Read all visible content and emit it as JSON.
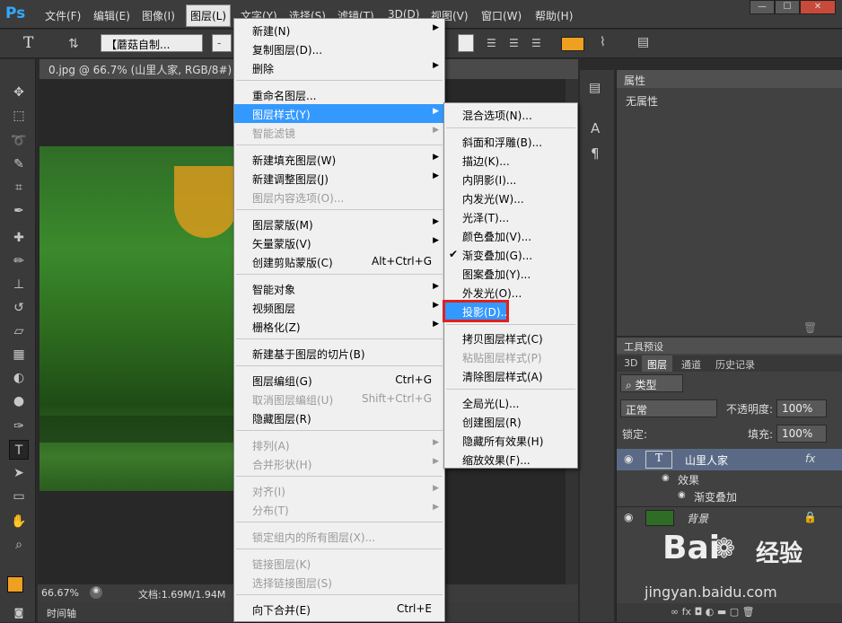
{
  "menubar": {
    "logo": "Ps",
    "items": [
      "文件(F)",
      "编辑(E)",
      "图像(I)",
      "图层(L)",
      "文字(Y)",
      "选择(S)",
      "滤镜(T)",
      "3D(D)",
      "视图(V)",
      "窗口(W)",
      "帮助(H)"
    ],
    "window_buttons": [
      "—",
      "☐",
      "✕"
    ]
  },
  "optbar": {
    "tool_icon": "T",
    "font_name": "【蘑菇自制...",
    "size_placeholder": "-"
  },
  "document": {
    "tab_title": "0.jpg @ 66.7% (山里人家, RGB/8#) *",
    "zoom": "66.67%",
    "doc_size": "文档:1.69M/1.94M",
    "timeline_label": "时间轴"
  },
  "properties": {
    "tab": "属性",
    "content": "无属性"
  },
  "panels": {
    "tool_presets": "工具预设",
    "tabs": [
      "3D",
      "图层",
      "通道",
      "历史记录"
    ],
    "filter_kind": "类型",
    "blend_mode": "正常",
    "opacity_label": "不透明度:",
    "opacity_value": "100%",
    "lock_label": "锁定:",
    "fill_label": "填充:",
    "fill_value": "100%",
    "layers": [
      {
        "name": "山里人家",
        "badge": "fx"
      },
      {
        "name": "效果"
      },
      {
        "name": "渐变叠加"
      },
      {
        "name": "背景"
      }
    ]
  },
  "layer_menu": {
    "items": [
      {
        "label": "新建(N)",
        "shortcut": "",
        "arrow": "▶",
        "disabled": false
      },
      {
        "label": "复制图层(D)...",
        "shortcut": "",
        "arrow": "",
        "disabled": false
      },
      {
        "label": "删除",
        "shortcut": "",
        "arrow": "▶",
        "disabled": false
      },
      {
        "label": "重命名图层...",
        "shortcut": "",
        "arrow": "",
        "disabled": false
      },
      {
        "label": "图层样式(Y)",
        "shortcut": "",
        "arrow": "▶",
        "disabled": false
      },
      {
        "label": "智能滤镜",
        "shortcut": "",
        "arrow": "▶",
        "disabled": true
      },
      {
        "label": "新建填充图层(W)",
        "shortcut": "",
        "arrow": "▶",
        "disabled": false
      },
      {
        "label": "新建调整图层(J)",
        "shortcut": "",
        "arrow": "▶",
        "disabled": false
      },
      {
        "label": "图层内容选项(O)...",
        "shortcut": "",
        "arrow": "",
        "disabled": true
      },
      {
        "label": "图层蒙版(M)",
        "shortcut": "",
        "arrow": "▶",
        "disabled": false
      },
      {
        "label": "矢量蒙版(V)",
        "shortcut": "",
        "arrow": "▶",
        "disabled": false
      },
      {
        "label": "创建剪贴蒙版(C)",
        "shortcut": "Alt+Ctrl+G",
        "arrow": "",
        "disabled": false
      },
      {
        "label": "智能对象",
        "shortcut": "",
        "arrow": "▶",
        "disabled": false
      },
      {
        "label": "视频图层",
        "shortcut": "",
        "arrow": "▶",
        "disabled": false
      },
      {
        "label": "栅格化(Z)",
        "shortcut": "",
        "arrow": "▶",
        "disabled": false
      },
      {
        "label": "新建基于图层的切片(B)",
        "shortcut": "",
        "arrow": "",
        "disabled": false
      },
      {
        "label": "图层编组(G)",
        "shortcut": "Ctrl+G",
        "arrow": "",
        "disabled": false
      },
      {
        "label": "取消图层编组(U)",
        "shortcut": "Shift+Ctrl+G",
        "arrow": "",
        "disabled": true
      },
      {
        "label": "隐藏图层(R)",
        "shortcut": "",
        "arrow": "",
        "disabled": false
      },
      {
        "label": "排列(A)",
        "shortcut": "",
        "arrow": "▶",
        "disabled": true
      },
      {
        "label": "合并形状(H)",
        "shortcut": "",
        "arrow": "▶",
        "disabled": true
      },
      {
        "label": "对齐(I)",
        "shortcut": "",
        "arrow": "▶",
        "disabled": true
      },
      {
        "label": "分布(T)",
        "shortcut": "",
        "arrow": "▶",
        "disabled": true
      },
      {
        "label": "锁定组内的所有图层(X)...",
        "shortcut": "",
        "arrow": "",
        "disabled": true
      },
      {
        "label": "链接图层(K)",
        "shortcut": "",
        "arrow": "",
        "disabled": true
      },
      {
        "label": "选择链接图层(S)",
        "shortcut": "",
        "arrow": "",
        "disabled": true
      },
      {
        "label": "向下合并(E)",
        "shortcut": "Ctrl+E",
        "arrow": "",
        "disabled": false
      }
    ]
  },
  "style_submenu": {
    "items": [
      {
        "label": "混合选项(N)...",
        "disabled": false,
        "check": ""
      },
      {
        "label": "斜面和浮雕(B)...",
        "disabled": false,
        "check": ""
      },
      {
        "label": "描边(K)...",
        "disabled": false,
        "check": ""
      },
      {
        "label": "内阴影(I)...",
        "disabled": false,
        "check": ""
      },
      {
        "label": "内发光(W)...",
        "disabled": false,
        "check": ""
      },
      {
        "label": "光泽(T)...",
        "disabled": false,
        "check": ""
      },
      {
        "label": "颜色叠加(V)...",
        "disabled": false,
        "check": ""
      },
      {
        "label": "渐变叠加(G)...",
        "disabled": false,
        "check": "✔"
      },
      {
        "label": "图案叠加(Y)...",
        "disabled": false,
        "check": ""
      },
      {
        "label": "外发光(O)...",
        "disabled": false,
        "check": ""
      },
      {
        "label": "投影(D)...",
        "disabled": false,
        "check": ""
      },
      {
        "label": "拷贝图层样式(C)",
        "disabled": false,
        "check": ""
      },
      {
        "label": "粘贴图层样式(P)",
        "disabled": true,
        "check": ""
      },
      {
        "label": "清除图层样式(A)",
        "disabled": false,
        "check": ""
      },
      {
        "label": "全局光(L)...",
        "disabled": false,
        "check": ""
      },
      {
        "label": "创建图层(R)",
        "disabled": false,
        "check": ""
      },
      {
        "label": "隐藏所有效果(H)",
        "disabled": false,
        "check": ""
      },
      {
        "label": "缩放效果(F)...",
        "disabled": false,
        "check": ""
      }
    ]
  },
  "watermark": {
    "brand": "Bai",
    "brand2": "经验",
    "url": "jingyan.baidu.com"
  },
  "colors": {
    "highlight": "#3399ff",
    "foreground": "#f0a020",
    "annotation_box": "#e02020"
  }
}
